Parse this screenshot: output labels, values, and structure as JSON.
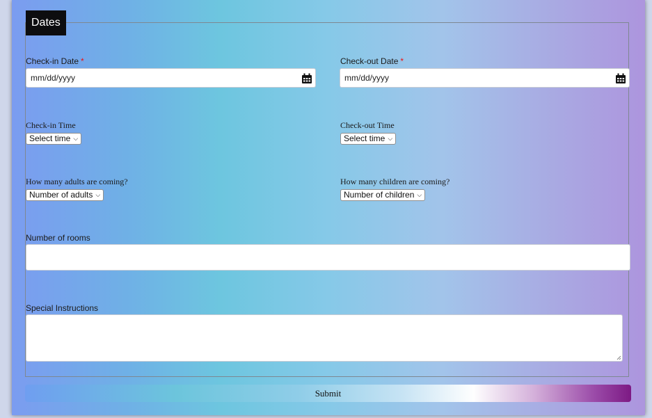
{
  "form": {
    "legend": "Dates",
    "checkin_date": {
      "label": "Check-in Date",
      "required_mark": "*",
      "value": "mm/dd/yyyy"
    },
    "checkout_date": {
      "label": "Check-out Date",
      "required_mark": "*",
      "value": "mm/dd/yyyy"
    },
    "checkin_time": {
      "label": "Check-in Time",
      "selected": "Select time"
    },
    "checkout_time": {
      "label": "Check-out Time",
      "selected": "Select time"
    },
    "adults": {
      "label": "How many adults are coming?",
      "selected": "Number of adults"
    },
    "children": {
      "label": "How many children are coming?",
      "selected": "Number of children"
    },
    "rooms": {
      "label": "Number of rooms",
      "value": ""
    },
    "instructions": {
      "label": "Special Instructions",
      "value": ""
    },
    "submit_label": "Submit"
  },
  "icons": {
    "calendar": "calendar-icon",
    "dropdown": "chevron-down-icon"
  },
  "colors": {
    "legend_bg": "#0d0d0f",
    "required": "#e11111",
    "submit_end": "#7d1a84"
  }
}
